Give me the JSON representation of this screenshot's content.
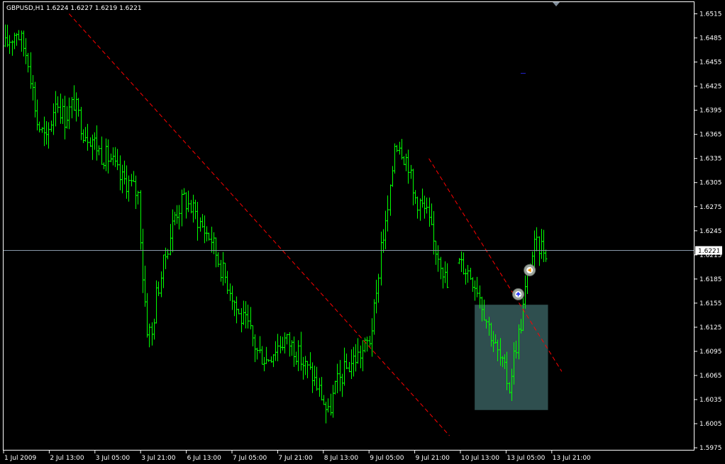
{
  "header": {
    "text": "GBPUSD,H1  1.6224 1.6227 1.6219 1.6221"
  },
  "colors": {
    "background": "#000000",
    "axis": "#ffffff",
    "bars": "#00ff00",
    "trendline": "#ff0000",
    "bidline": "#8899aa",
    "rectangle": "#2f4f4f"
  },
  "icons": {
    "top_marker": "triangle-down-icon",
    "buy_arrow": "buy-arrow-icon",
    "sell_arrow": "sell-arrow-icon"
  },
  "chart_data": {
    "type": "ohlc",
    "symbol": "GBPUSD",
    "timeframe": "H1",
    "last": {
      "open": 1.6224,
      "high": 1.6227,
      "low": 1.6219,
      "close": 1.6221
    },
    "current_price": "1.6221",
    "ylim": [
      1.5972,
      1.653
    ],
    "y_ticks": [
      "1.6515",
      "1.6485",
      "1.6455",
      "1.6425",
      "1.6395",
      "1.6365",
      "1.6335",
      "1.6305",
      "1.6275",
      "1.6245",
      "1.6215",
      "1.6185",
      "1.6155",
      "1.6125",
      "1.6095",
      "1.6065",
      "1.6035",
      "1.6005",
      "1.5975"
    ],
    "x_ticks": [
      "1 Jul 2009",
      "2 Jul 13:00",
      "3 Jul 05:00",
      "3 Jul 21:00",
      "6 Jul 13:00",
      "7 Jul 05:00",
      "7 Jul 21:00",
      "8 Jul 13:00",
      "9 Jul 05:00",
      "9 Jul 21:00",
      "10 Jul 13:00",
      "13 Jul 05:00",
      "13 Jul 21:00"
    ],
    "n_bars": 194,
    "path": [
      [
        0,
        1.6475
      ],
      [
        5,
        1.6495
      ],
      [
        10,
        1.646
      ],
      [
        14,
        1.638
      ],
      [
        18,
        1.6355
      ],
      [
        22,
        1.641
      ],
      [
        26,
        1.6385
      ],
      [
        30,
        1.6405
      ],
      [
        34,
        1.637
      ],
      [
        38,
        1.636
      ],
      [
        42,
        1.634
      ],
      [
        46,
        1.6335
      ],
      [
        50,
        1.631
      ],
      [
        54,
        1.6305
      ],
      [
        58,
        1.629
      ],
      [
        60,
        1.619
      ],
      [
        62,
        1.6125
      ],
      [
        64,
        1.6115
      ],
      [
        66,
        1.6165
      ],
      [
        70,
        1.6215
      ],
      [
        74,
        1.6265
      ],
      [
        78,
        1.6285
      ],
      [
        82,
        1.627
      ],
      [
        86,
        1.625
      ],
      [
        90,
        1.6235
      ],
      [
        94,
        1.62
      ],
      [
        98,
        1.6175
      ],
      [
        102,
        1.614
      ],
      [
        106,
        1.6125
      ],
      [
        110,
        1.6095
      ],
      [
        114,
        1.6085
      ],
      [
        118,
        1.61
      ],
      [
        122,
        1.611
      ],
      [
        126,
        1.61
      ],
      [
        130,
        1.608
      ],
      [
        134,
        1.6065
      ],
      [
        138,
        1.604
      ],
      [
        141,
        1.6015
      ],
      [
        144,
        1.605
      ],
      [
        148,
        1.607
      ],
      [
        152,
        1.6085
      ],
      [
        156,
        1.6095
      ],
      [
        159,
        1.611
      ],
      [
        162,
        1.616
      ],
      [
        164,
        1.623
      ],
      [
        166,
        1.625
      ],
      [
        168,
        1.629
      ],
      [
        170,
        1.6355
      ],
      [
        172,
        1.6355
      ],
      [
        174,
        1.634
      ],
      [
        176,
        1.633
      ],
      [
        178,
        1.629
      ],
      [
        181,
        1.628
      ],
      [
        184,
        1.6265
      ],
      [
        187,
        1.623
      ],
      [
        190,
        1.621
      ],
      [
        193,
        1.6175
      ]
    ],
    "trendlines": [
      {
        "from": {
          "bar": 28,
          "price": 1.6515
        },
        "to": {
          "bar": 194,
          "price": 1.599
        }
      },
      {
        "from": {
          "bar": 185,
          "price": 1.6335
        },
        "to": {
          "bar": 243,
          "price": 1.607
        }
      }
    ],
    "rectangle": {
      "bar_from": 205,
      "bar_to": 237,
      "price_top": 1.6153,
      "price_bottom": 1.6022
    },
    "signals": [
      {
        "type": "buy",
        "bar": 224,
        "price": 1.6166
      },
      {
        "type": "sell",
        "bar": 229,
        "price": 1.6196
      }
    ],
    "ask_marker": {
      "bar": 226,
      "price": 1.6441
    }
  }
}
